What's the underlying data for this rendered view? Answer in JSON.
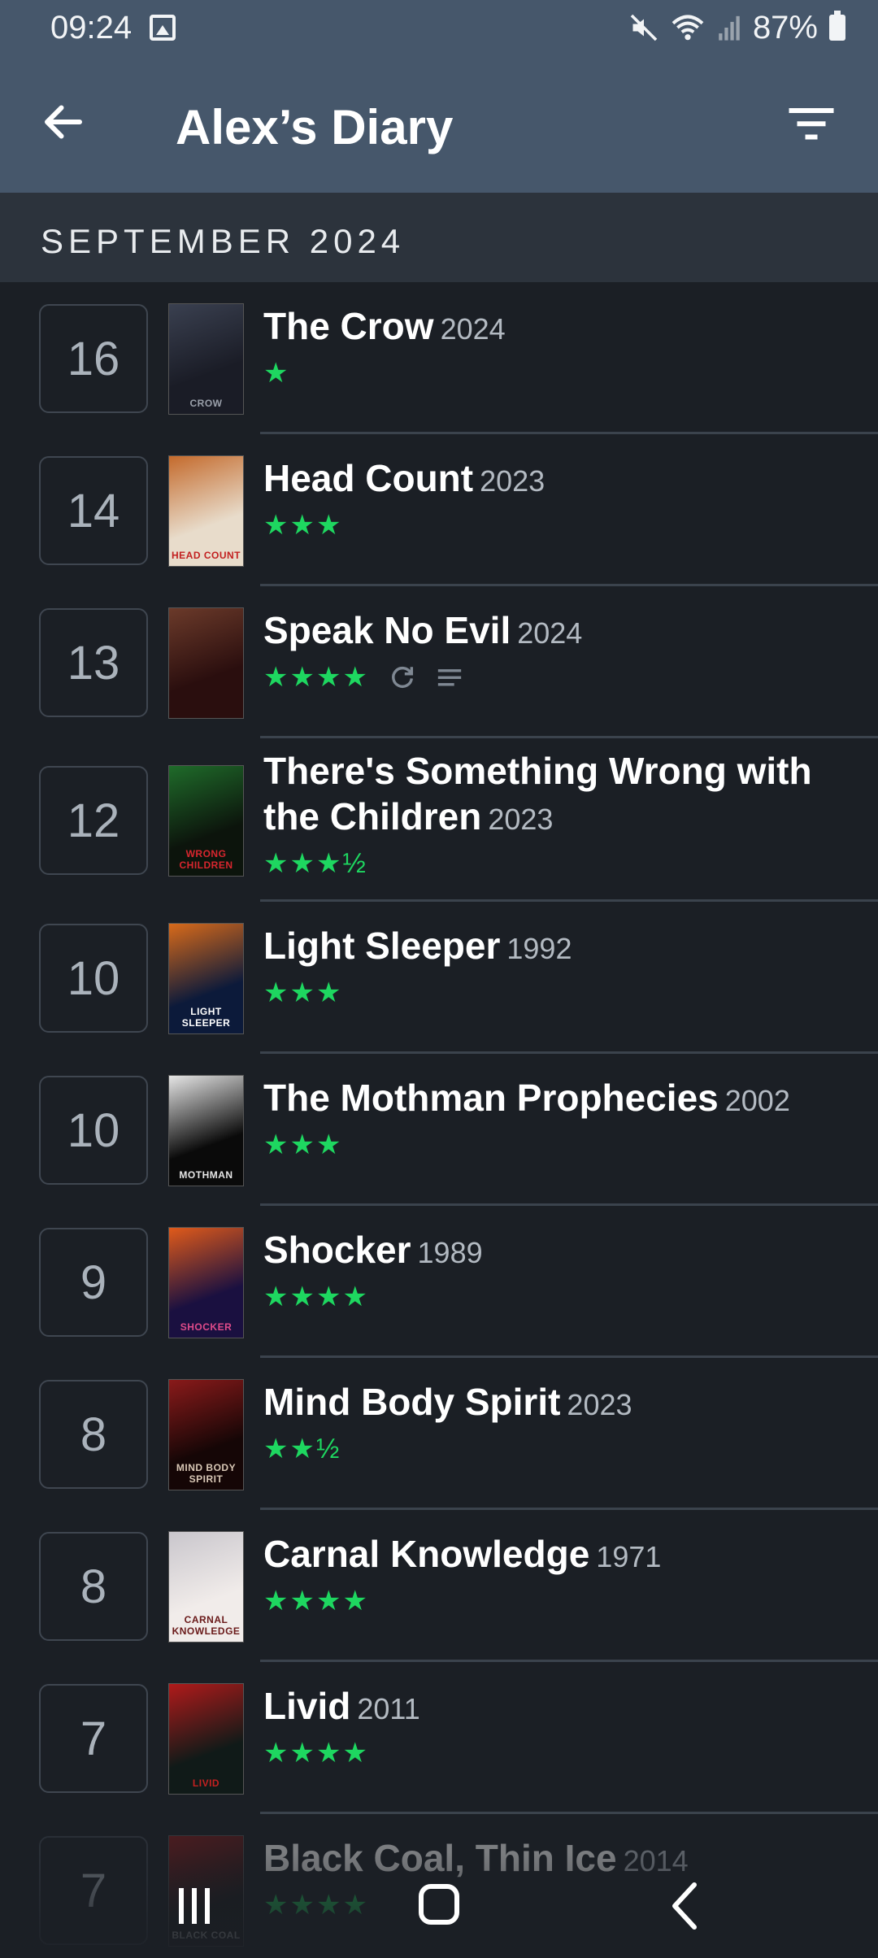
{
  "status": {
    "time": "09:24",
    "battery": "87%"
  },
  "appbar": {
    "title": "Alex’s Diary"
  },
  "section": {
    "label": "SEPTEMBER 2024"
  },
  "colors": {
    "header": "#46576b",
    "background": "#1b1f25",
    "rating_green": "#1ed760"
  },
  "entries": [
    {
      "day": "16",
      "title": "The Crow",
      "year": "2024",
      "rating": "★",
      "rewatch": false,
      "review": false,
      "poster": {
        "bg": "#1a1c26",
        "accent": "#3a4050",
        "label": "CROW",
        "label_color": "#9aa0aa"
      }
    },
    {
      "day": "14",
      "title": "Head Count",
      "year": "2023",
      "rating": "★★★",
      "rewatch": false,
      "review": false,
      "poster": {
        "bg": "#e8dccb",
        "accent": "#c46a2c",
        "label": "HEAD COUNT",
        "label_color": "#c21f1f"
      }
    },
    {
      "day": "13",
      "title": "Speak No Evil",
      "year": "2024",
      "rating": "★★★★",
      "rewatch": true,
      "review": true,
      "poster": {
        "bg": "#2a0e0e",
        "accent": "#6b3a2a",
        "label": "",
        "label_color": "#ffffff"
      }
    },
    {
      "day": "12",
      "title": "There's Something Wrong with the Children",
      "year": "2023",
      "rating": "★★★½",
      "rewatch": false,
      "review": false,
      "poster": {
        "bg": "#0c140c",
        "accent": "#1f6b2a",
        "label": "WRONG CHILDREN",
        "label_color": "#d8262e"
      }
    },
    {
      "day": "10",
      "title": "Light Sleeper",
      "year": "1992",
      "rating": "★★★",
      "rewatch": false,
      "review": false,
      "poster": {
        "bg": "#0c1a3a",
        "accent": "#d86a1a",
        "label": "LIGHT SLEEPER",
        "label_color": "#ffffff"
      }
    },
    {
      "day": "10",
      "title": "The Mothman Prophecies",
      "year": "2002",
      "rating": "★★★",
      "rewatch": false,
      "review": false,
      "poster": {
        "bg": "#0a0a0a",
        "accent": "#e6e6e6",
        "label": "MOTHMAN",
        "label_color": "#e6e6e6"
      }
    },
    {
      "day": "9",
      "title": "Shocker",
      "year": "1989",
      "rating": "★★★★",
      "rewatch": false,
      "review": false,
      "poster": {
        "bg": "#1a1040",
        "accent": "#e05a1a",
        "label": "SHOCKER",
        "label_color": "#e04b8a"
      }
    },
    {
      "day": "8",
      "title": "Mind Body Spirit",
      "year": "2023",
      "rating": "★★½",
      "rewatch": false,
      "review": false,
      "poster": {
        "bg": "#150606",
        "accent": "#8a1a1a",
        "label": "MIND BODY SPIRIT",
        "label_color": "#d8c7b5"
      }
    },
    {
      "day": "8",
      "title": "Carnal Knowledge",
      "year": "1971",
      "rating": "★★★★",
      "rewatch": false,
      "review": false,
      "poster": {
        "bg": "#f1ecea",
        "accent": "#c9c6cc",
        "label": "CARNAL KNOWLEDGE",
        "label_color": "#6a1a1a"
      }
    },
    {
      "day": "7",
      "title": "Livid",
      "year": "2011",
      "rating": "★★★★",
      "rewatch": false,
      "review": false,
      "poster": {
        "bg": "#101a18",
        "accent": "#b01a1a",
        "label": "LIVID",
        "label_color": "#c32020"
      }
    },
    {
      "day": "7",
      "title": "Black Coal, Thin Ice",
      "year": "2014",
      "rating": "★★★★",
      "rewatch": false,
      "review": false,
      "poster": {
        "bg": "#1a1a1a",
        "accent": "#8a1a1a",
        "label": "BLACK COAL",
        "label_color": "#d6d6d6"
      }
    }
  ]
}
